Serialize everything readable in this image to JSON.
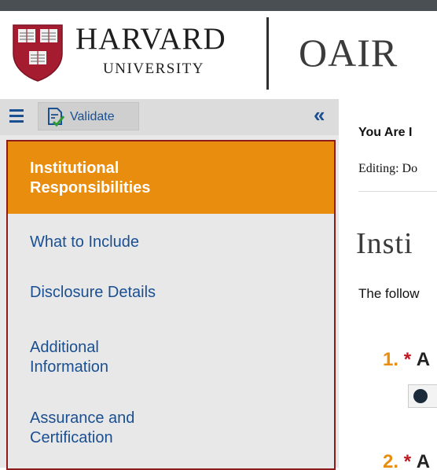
{
  "header": {
    "org_name": "HARVARD",
    "org_sub": "UNIVERSITY",
    "app_name": "OAIR",
    "colors": {
      "topbar": "#4a4f54",
      "crimson": "#a51c30"
    }
  },
  "toolbar": {
    "menu_icon": "hamburger-icon",
    "validate_label": "Validate",
    "validate_icon": "document-check-icon",
    "collapse_icon": "«"
  },
  "sidebar": {
    "items": [
      {
        "label": "Institutional Responsibilities",
        "active": true
      },
      {
        "label": "What to Include",
        "active": false
      },
      {
        "label": "Disclosure Details",
        "active": false
      },
      {
        "label": "Additional Information",
        "active": false
      },
      {
        "label": "Assurance and Certification",
        "active": false
      }
    ],
    "colors": {
      "active_bg": "#e98d0f",
      "link": "#1a4f91",
      "border": "#8c1b1b"
    }
  },
  "main": {
    "you_are": "You Are I",
    "editing": "Editing: Do",
    "page_title": "Insti",
    "intro": "The follow",
    "questions": [
      {
        "number": "1.",
        "required": "*",
        "text": "A"
      },
      {
        "number": "2.",
        "required": "*",
        "text": "A"
      }
    ]
  }
}
